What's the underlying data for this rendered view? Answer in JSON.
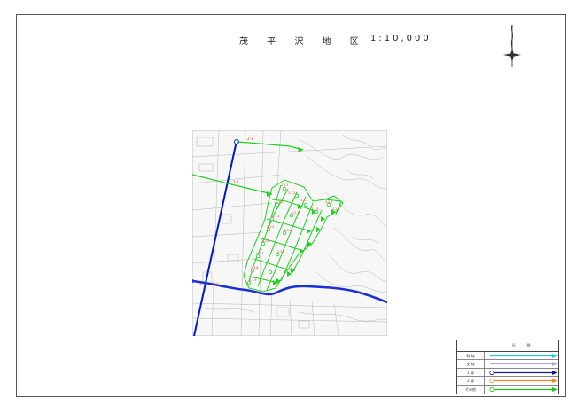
{
  "sheet": {
    "title": "茂 平 沢 地 区",
    "scale": "1:10,000"
  },
  "map": {
    "colors": {
      "main_channel": "#0018c8",
      "river": "#1a2fd6",
      "other_channel": "#20d020",
      "label": "#e03030",
      "topo": "#b8b8b8"
    },
    "channel_labels": [
      "2-1",
      "2-2",
      "3-1",
      "3-2"
    ]
  },
  "legend": {
    "header_left": "凡",
    "header_right": "例",
    "rows": [
      {
        "label": "幹 線",
        "color": "#22c8e0",
        "marker": "none"
      },
      {
        "label": "支 線",
        "color": "#b8a0e0",
        "marker": "none"
      },
      {
        "label": "1 級",
        "color": "#1a1a8a",
        "marker": "circle"
      },
      {
        "label": "2 級",
        "color": "#f08a30",
        "marker": "circle"
      },
      {
        "label": "その他",
        "color": "#20c020",
        "marker": "circle"
      }
    ]
  }
}
